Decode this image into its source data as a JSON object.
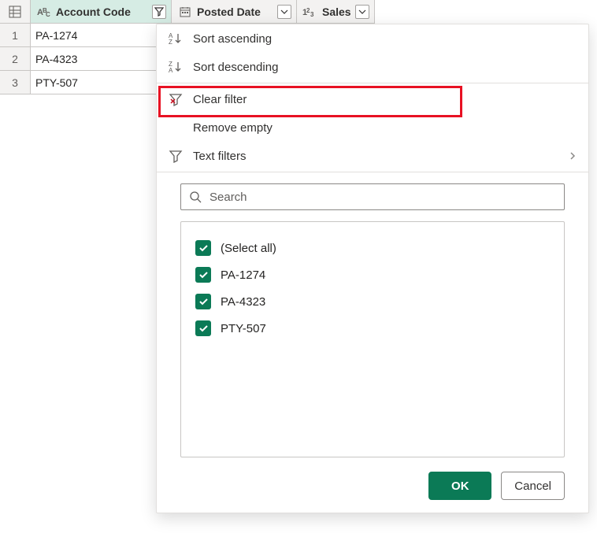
{
  "columns": {
    "account_code": {
      "label": "Account Code",
      "type_icon": "text-type"
    },
    "posted_date": {
      "label": "Posted Date",
      "type_icon": "date-type"
    },
    "sales": {
      "label": "Sales",
      "type_icon": "number-type"
    }
  },
  "rows": [
    {
      "num": "1",
      "account_code": "PA-1274"
    },
    {
      "num": "2",
      "account_code": "PA-4323"
    },
    {
      "num": "3",
      "account_code": "PTY-507"
    }
  ],
  "menu": {
    "sort_asc": "Sort ascending",
    "sort_desc": "Sort descending",
    "clear_filter": "Clear filter",
    "remove_empty": "Remove empty",
    "text_filters": "Text filters"
  },
  "search": {
    "placeholder": "Search"
  },
  "filter_values": {
    "select_all": "(Select all)",
    "items": [
      "PA-1274",
      "PA-4323",
      "PTY-507"
    ]
  },
  "buttons": {
    "ok": "OK",
    "cancel": "Cancel"
  },
  "accent_color": "#0b7a56",
  "highlight_color": "#e81123"
}
